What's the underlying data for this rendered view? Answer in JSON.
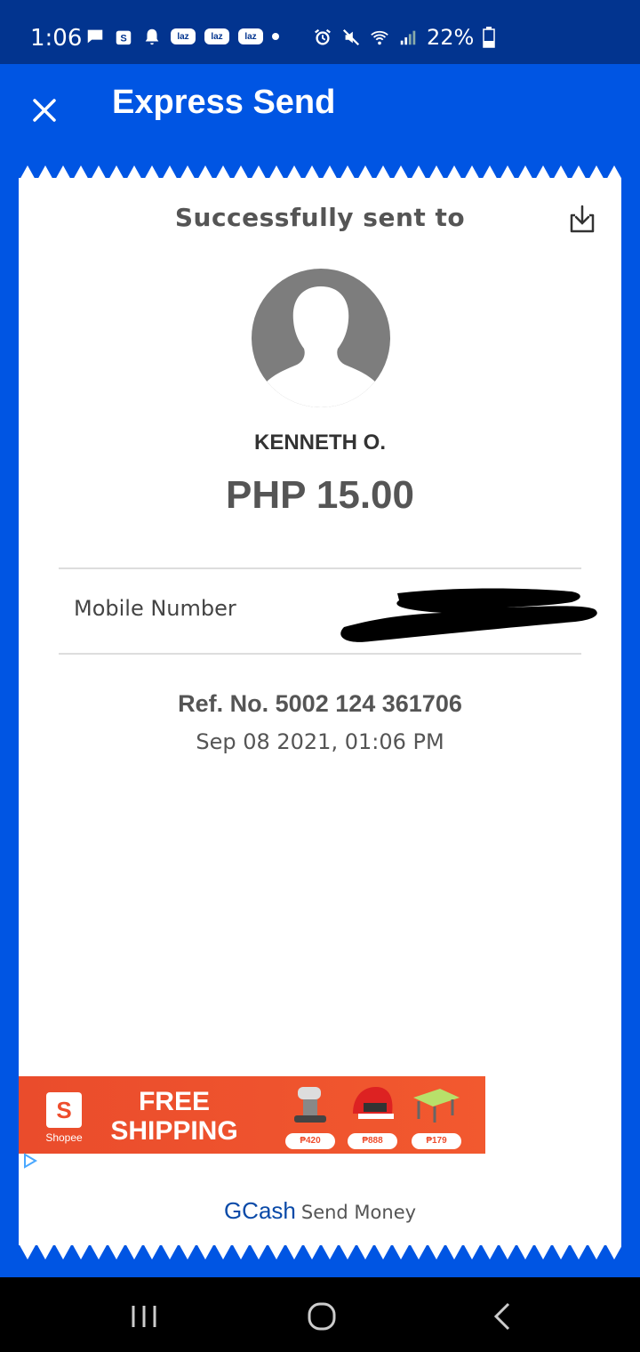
{
  "status_bar": {
    "time": "1:06",
    "battery_percent": "22%"
  },
  "app_bar": {
    "title": "Express Send"
  },
  "receipt": {
    "heading": "Successfully sent to",
    "recipient_name": "KENNETH O.",
    "amount": "PHP 15.00",
    "mobile_label": "Mobile Number",
    "ref_no": "Ref. No. 5002 124 361706",
    "datetime": "Sep 08 2021, 01:06 PM"
  },
  "ad": {
    "brand": "Shopee",
    "headline_line1": "FREE",
    "headline_line2": "SHIPPING",
    "prices": [
      "₱420",
      "₱888",
      "₱179"
    ]
  },
  "footer": {
    "brand": "GCash",
    "subtitle": "Send Money"
  },
  "colors": {
    "primary_blue": "#0055e3",
    "status_bar": "#02348f",
    "ad_orange": "#ee4d2d"
  }
}
